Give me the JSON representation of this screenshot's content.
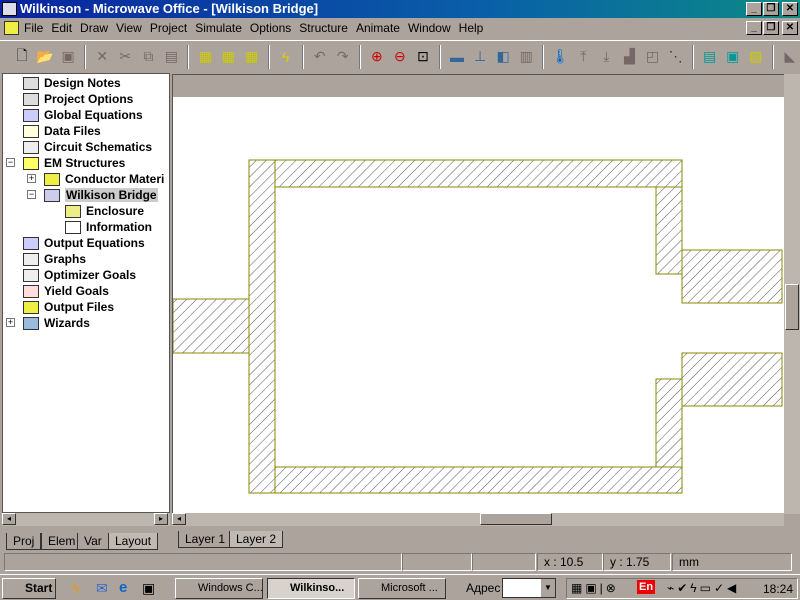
{
  "window": {
    "title": "Wilkinson - Microwave Office - [Wilkison Bridge]"
  },
  "menu": [
    "File",
    "Edit",
    "Draw",
    "View",
    "Project",
    "Simulate",
    "Options",
    "Structure",
    "Animate",
    "Window",
    "Help"
  ],
  "tree": [
    {
      "label": "Design Notes",
      "icon": "notes-icon"
    },
    {
      "label": "Project Options",
      "icon": "options-icon"
    },
    {
      "label": "Global Equations",
      "icon": "equations-icon"
    },
    {
      "label": "Data Files",
      "icon": "folder-icon"
    },
    {
      "label": "Circuit Schematics",
      "icon": "schematic-icon"
    },
    {
      "label": "EM Structures",
      "icon": "em-icon"
    },
    {
      "label": "Conductor Materi",
      "icon": "conductor-icon"
    },
    {
      "label": "Wilkison Bridge",
      "icon": "em-structure-icon"
    },
    {
      "label": "Enclosure",
      "icon": "enclosure-icon"
    },
    {
      "label": "Information",
      "icon": "info-icon"
    },
    {
      "label": "Output Equations",
      "icon": "equations-icon"
    },
    {
      "label": "Graphs",
      "icon": "graph-icon"
    },
    {
      "label": "Optimizer Goals",
      "icon": "goals-icon"
    },
    {
      "label": "Yield Goals",
      "icon": "yield-icon"
    },
    {
      "label": "Output Files",
      "icon": "output-icon"
    },
    {
      "label": "Wizards",
      "icon": "wizard-icon"
    }
  ],
  "left_tabs": [
    "Proj",
    "Elem",
    "Var",
    "Layout"
  ],
  "layer_tabs": [
    "Layer 1",
    "Layer 2"
  ],
  "status": {
    "x": "x : 10.5",
    "y": "y : 1.75",
    "unit": "mm"
  },
  "taskbar": {
    "start": "Start",
    "tasks": [
      "Windows C...",
      "Wilkinso...",
      "Microsoft ..."
    ],
    "address_label": "Адрес",
    "clock": "18:24",
    "lang": "En"
  },
  "colors": {
    "title_start": "#0a24a0",
    "conductor_edge": "#8a8a00"
  }
}
